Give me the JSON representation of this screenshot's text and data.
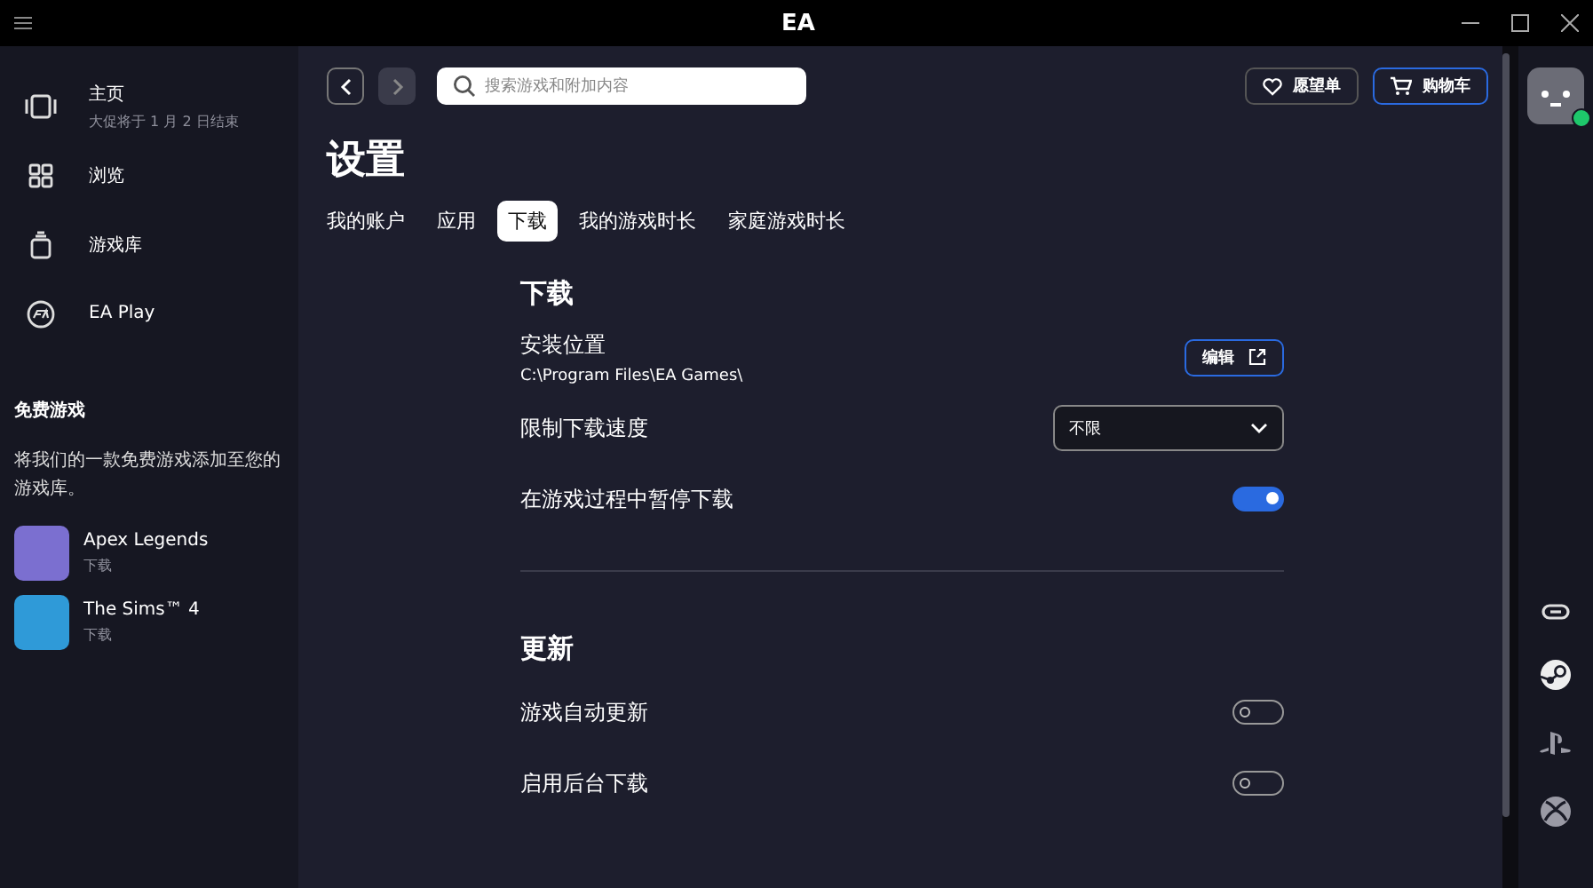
{
  "window": {
    "title": "EA"
  },
  "sidebar": {
    "items": [
      {
        "label": "主页",
        "sublabel": "大促将于 1 月 2 日结束",
        "selected": false
      },
      {
        "label": "浏览",
        "selected": false
      },
      {
        "label": "游戏库",
        "selected": false
      },
      {
        "label": "EA Play",
        "selected": false
      }
    ],
    "free_games": {
      "title": "免费游戏",
      "description": "将我们的一款免费游戏添加至您的游戏库。",
      "games": [
        {
          "name": "Apex Legends",
          "action": "下载",
          "color": "#7b6fd0"
        },
        {
          "name": "The Sims™ 4",
          "action": "下载",
          "color": "#2f9ad8"
        }
      ]
    }
  },
  "search": {
    "placeholder": "搜索游戏和附加内容"
  },
  "header_buttons": [
    {
      "label": "愿望单",
      "highlighted": false
    },
    {
      "label": "购物车",
      "highlighted": true
    }
  ],
  "page": {
    "title": "设置",
    "tabs": [
      {
        "label": "我的账户",
        "selected": false
      },
      {
        "label": "应用",
        "selected": false
      },
      {
        "label": "下载",
        "selected": true
      },
      {
        "label": "我的游戏时长",
        "selected": false
      },
      {
        "label": "家庭游戏时长",
        "selected": false
      }
    ]
  },
  "sections": [
    {
      "title": "下载",
      "settings": [
        {
          "kind": "button",
          "label": "安装位置",
          "value": "C:\\Program Files\\EA Games\\",
          "button": "编辑"
        },
        {
          "kind": "dropdown",
          "label": "限制下载速度",
          "value": "不限"
        },
        {
          "kind": "toggle",
          "label": "在游戏过程中暂停下载",
          "on": true
        }
      ]
    },
    {
      "title": "更新",
      "settings": [
        {
          "kind": "toggle",
          "label": "游戏自动更新",
          "on": false
        },
        {
          "kind": "toggle",
          "label": "启用后台下载",
          "on": false
        }
      ]
    }
  ]
}
